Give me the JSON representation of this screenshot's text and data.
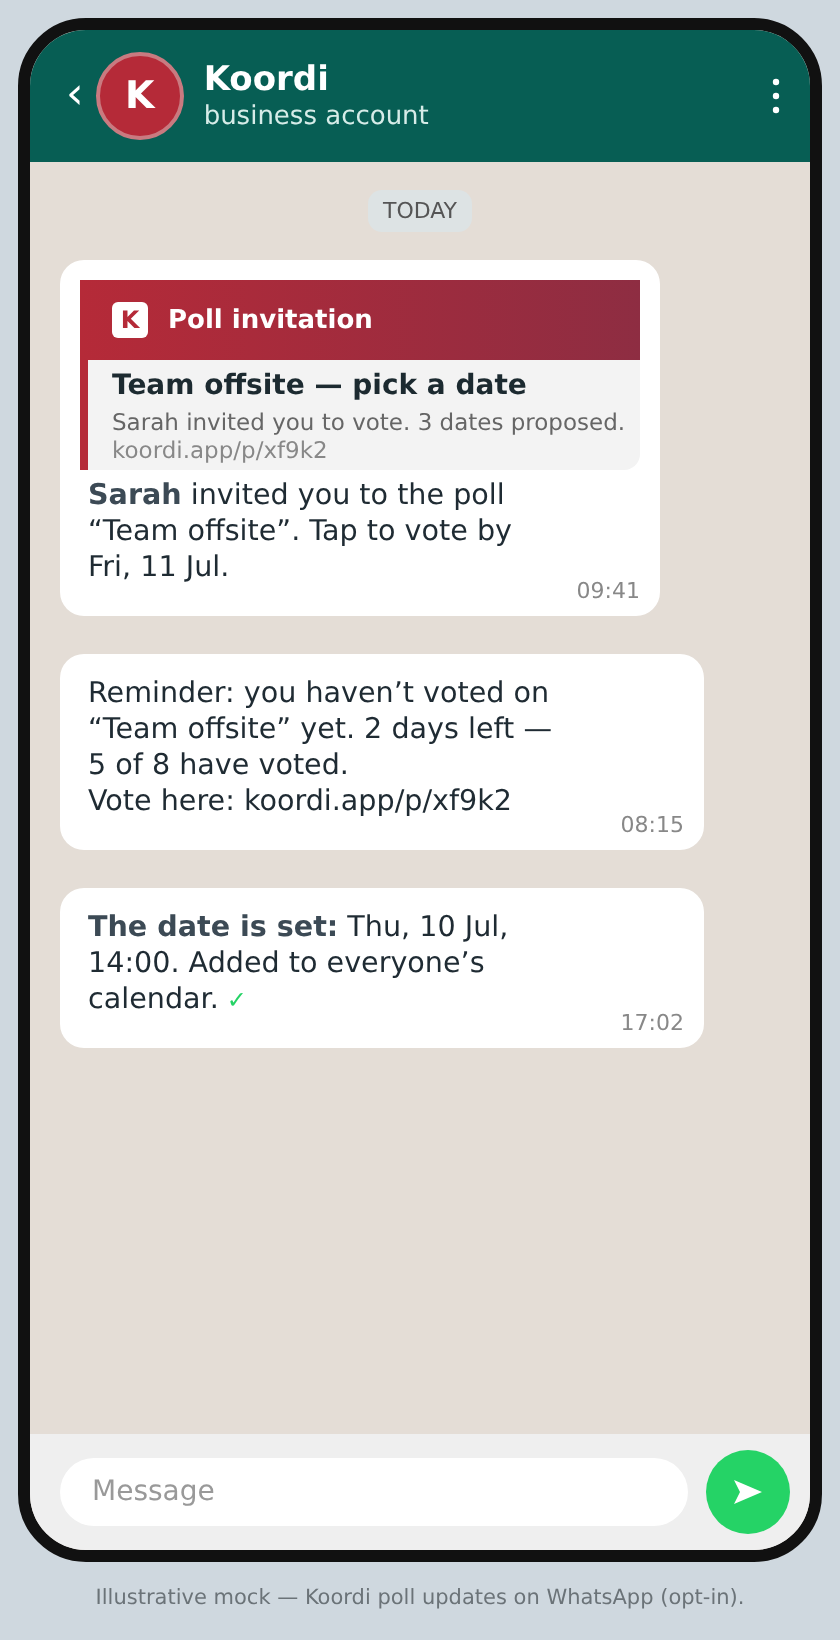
{
  "header": {
    "back": "‹",
    "avatar_letter": "K",
    "title": "Koordi",
    "subtitle": "business account"
  },
  "date_divider": "TODAY",
  "messages": [
    {
      "kind": "card",
      "card": {
        "logo_letter": "K",
        "label": "Poll invitation",
        "title": "Team offsite — pick a date",
        "description": "Sarah invited you to vote. 3 dates proposed.",
        "url": "koordi.app/p/xf9k2"
      },
      "lines": [
        "**Sarah** invited you to the poll",
        "“Team offsite”. Tap to vote by",
        "Fri, 11 Jul."
      ],
      "time": "09:41"
    },
    {
      "kind": "text",
      "lines": [
        "Reminder: you haven’t voted on",
        "“Team offsite” yet. 2 days left —",
        "5 of 8 have voted.",
        "Vote here: koordi.app/p/xf9k2"
      ],
      "time": "08:15"
    },
    {
      "kind": "text",
      "lines": [
        "**The date is set:** Thu, 10 Jul,",
        "14:00. Added to everyone’s",
        "calendar."
      ],
      "mark": "✓",
      "time": "17:02"
    }
  ],
  "composer": {
    "placeholder": "Message"
  },
  "caption": "Illustrative mock — Koordi poll updates on WhatsApp (opt-in)."
}
